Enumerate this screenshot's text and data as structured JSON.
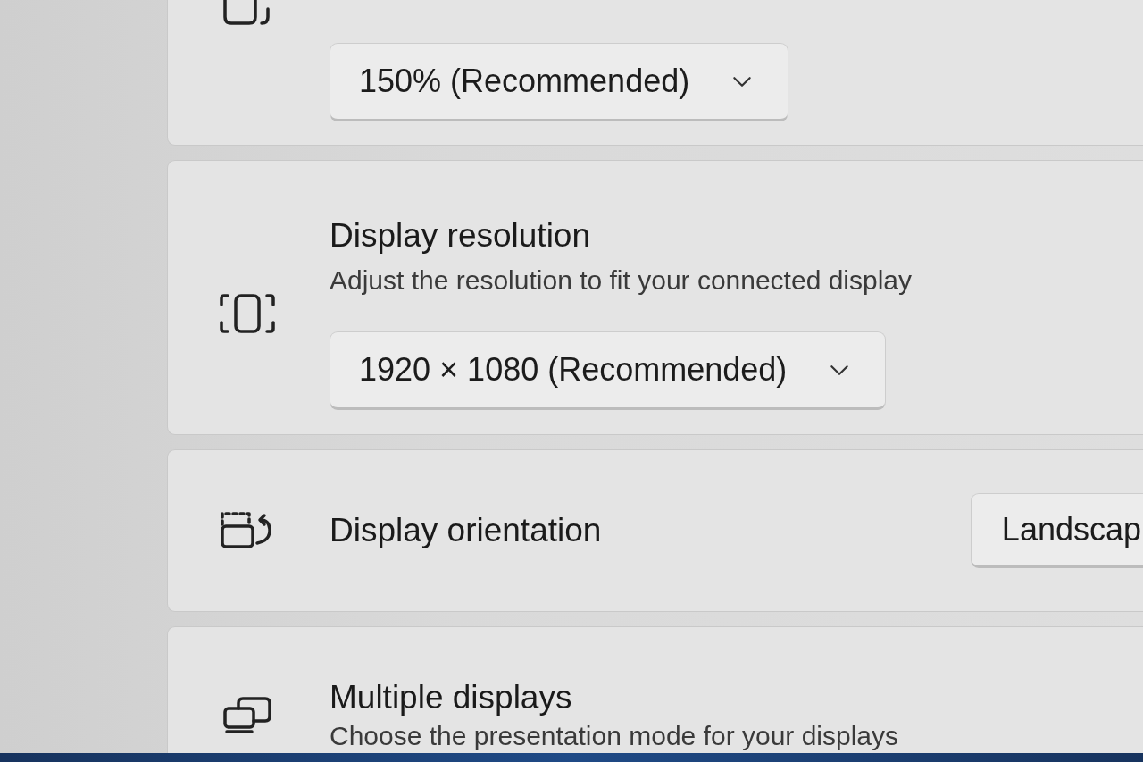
{
  "scale": {
    "dropdown": "150% (Recommended)"
  },
  "settings": [
    {
      "kind": "stacked",
      "title": "Display resolution",
      "description": "Adjust the resolution to fit your connected display",
      "dropdown": "1920 × 1080 (Recommended)"
    },
    {
      "kind": "inline",
      "title": "Display orientation",
      "dropdown": "Landscap"
    },
    {
      "kind": "plain",
      "title": "Multiple displays",
      "description": "Choose the presentation mode for your displays"
    }
  ]
}
